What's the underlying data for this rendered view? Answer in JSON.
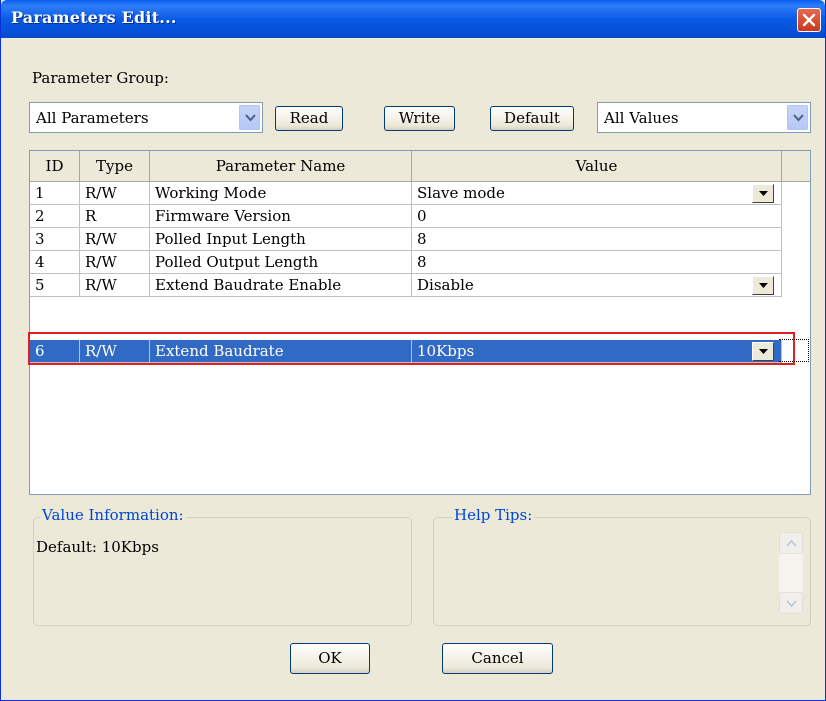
{
  "window": {
    "title": "Parameters Edit..."
  },
  "toolbar": {
    "group_label": "Parameter Group:",
    "group_selected": "All Parameters",
    "read_label": "Read",
    "write_label": "Write",
    "default_label": "Default",
    "values_selected": "All Values"
  },
  "table": {
    "headers": [
      "ID",
      "Type",
      "Parameter Name",
      "Value"
    ],
    "rows": [
      {
        "id": "1",
        "type": "R/W",
        "name": "Working Mode",
        "value": "Slave mode",
        "dropdown": true
      },
      {
        "id": "2",
        "type": "R",
        "name": "Firmware Version",
        "value": "0",
        "dropdown": false
      },
      {
        "id": "3",
        "type": "R/W",
        "name": "Polled Input Length",
        "value": "8",
        "dropdown": false
      },
      {
        "id": "4",
        "type": "R/W",
        "name": "Polled Output Length",
        "value": "8",
        "dropdown": false
      },
      {
        "id": "5",
        "type": "R/W",
        "name": "Extend Baudrate Enable",
        "value": "Disable",
        "dropdown": true
      },
      {
        "id": "6",
        "type": "R/W",
        "name": "Extend Baudrate",
        "value": "10Kbps",
        "dropdown": true
      }
    ],
    "selected_row": "6"
  },
  "value_info": {
    "legend": "Value Information:",
    "text": "Default:  10Kbps"
  },
  "help_tips": {
    "legend": "Help Tips:"
  },
  "footer": {
    "ok_label": "OK",
    "cancel_label": "Cancel"
  },
  "colors": {
    "title_bar": "#0a5ef0",
    "selection": "#316ac5",
    "highlight_outline": "#e02020",
    "group_legend": "#0046d5"
  }
}
